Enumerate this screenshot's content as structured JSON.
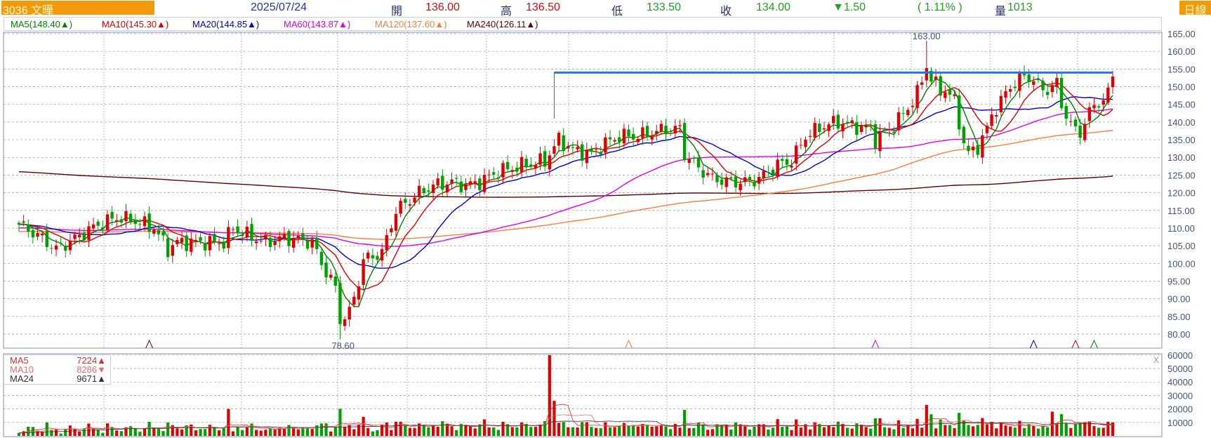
{
  "header": {
    "stock": "3036  文曄",
    "date": "2025/07/24",
    "open_label": "開",
    "open": "136.00",
    "high_label": "高",
    "high": "136.50",
    "low_label": "低",
    "low": "133.50",
    "close_label": "收",
    "close": "134.00",
    "change": "▼1.50",
    "change_pct": "( 1.11% )",
    "volume_label": "量",
    "volume": "1013",
    "period": "日線"
  },
  "ma_legend": [
    {
      "text": "MA5(148.40▲)",
      "color": "#008000"
    },
    {
      "text": "MA10(145.30▲)",
      "color": "#e00000"
    },
    {
      "text": "MA20(144.85▲)",
      "color": "#0000cc"
    },
    {
      "text": "MA60(143.87▲)",
      "color": "#e000e0"
    },
    {
      "text": "MA120(137.60▲)",
      "color": "#f08040"
    },
    {
      "text": "MA240(126.11▲)",
      "color": "#600000"
    }
  ],
  "volume_legend": [
    {
      "name": "MA5",
      "value": "7224▲",
      "color": "#d03030"
    },
    {
      "name": "MA10",
      "value": "8286▼",
      "color": "#e07070"
    },
    {
      "name": "MA24",
      "value": "9671▲",
      "color": "#333333"
    }
  ],
  "annotations": {
    "high_label": "163.00",
    "low_label": "78.60"
  },
  "colors": {
    "up": "#e00000",
    "down": "#00a000",
    "resistance": "#1e78e6",
    "grid": "#999999",
    "axis_text": "#445577"
  },
  "chart_data": {
    "type": "candlestick",
    "days": 236,
    "price_axis": {
      "min": 80,
      "max": 165,
      "step": 5,
      "ticks": [
        "165.00",
        "160.00",
        "155.00",
        "150.00",
        "145.00",
        "140.00",
        "135.00",
        "130.00",
        "125.00",
        "120.00",
        "115.00",
        "110.00",
        "105.00",
        "100.00",
        "95.00",
        "90.00",
        "85.00",
        "80.00"
      ]
    },
    "volume_axis": {
      "min": 0,
      "max": 60000,
      "ticks": [
        "60000",
        "50000",
        "40000",
        "30000",
        "20000",
        "10000"
      ]
    },
    "price_path": [
      [
        0,
        111
      ],
      [
        4,
        108
      ],
      [
        8,
        104
      ],
      [
        12,
        107
      ],
      [
        17,
        111
      ],
      [
        21,
        113
      ],
      [
        25,
        112
      ],
      [
        29,
        110
      ],
      [
        32,
        104
      ],
      [
        34,
        106
      ],
      [
        39,
        106
      ],
      [
        44,
        106
      ],
      [
        46,
        110
      ],
      [
        49,
        108
      ],
      [
        53,
        106
      ],
      [
        56,
        107
      ],
      [
        59,
        107
      ],
      [
        63,
        106
      ],
      [
        65,
        100
      ],
      [
        68,
        93
      ],
      [
        69,
        84
      ],
      [
        71,
        86
      ],
      [
        73,
        95
      ],
      [
        74,
        101
      ],
      [
        78,
        103
      ],
      [
        79,
        107
      ],
      [
        81,
        115
      ],
      [
        83,
        117
      ],
      [
        86,
        120
      ],
      [
        89,
        122
      ],
      [
        93,
        123
      ],
      [
        96,
        122
      ],
      [
        99,
        123
      ],
      [
        103,
        126
      ],
      [
        106,
        127
      ],
      [
        109,
        128
      ],
      [
        113,
        129
      ],
      [
        116,
        135
      ],
      [
        119,
        132
      ],
      [
        123,
        131
      ],
      [
        126,
        134
      ],
      [
        129,
        136
      ],
      [
        133,
        136
      ],
      [
        136,
        137
      ],
      [
        139,
        138
      ],
      [
        142,
        138
      ],
      [
        143,
        131
      ],
      [
        146,
        127
      ],
      [
        149,
        124
      ],
      [
        153,
        123
      ],
      [
        156,
        123
      ],
      [
        159,
        124
      ],
      [
        163,
        128
      ],
      [
        166,
        129
      ],
      [
        169,
        136
      ],
      [
        173,
        139
      ],
      [
        176,
        140
      ],
      [
        179,
        139
      ],
      [
        183,
        138
      ],
      [
        184,
        135
      ],
      [
        188,
        139
      ],
      [
        191,
        144
      ],
      [
        193,
        148
      ],
      [
        195,
        156
      ],
      [
        196,
        152
      ],
      [
        198,
        149
      ],
      [
        199,
        149
      ],
      [
        201,
        146
      ],
      [
        203,
        134
      ],
      [
        204,
        131
      ],
      [
        206,
        133
      ],
      [
        208,
        138
      ],
      [
        209,
        142
      ],
      [
        211,
        146
      ],
      [
        213,
        150
      ],
      [
        214,
        151
      ],
      [
        216,
        153
      ],
      [
        218,
        152
      ],
      [
        219,
        150
      ],
      [
        221,
        149
      ],
      [
        223,
        151
      ],
      [
        224,
        145
      ],
      [
        226,
        139
      ],
      [
        228,
        137
      ],
      [
        229,
        140
      ],
      [
        231,
        145
      ],
      [
        233,
        146
      ],
      [
        234,
        148
      ],
      [
        235,
        154
      ]
    ],
    "volume_spikes": [
      [
        45,
        20000
      ],
      [
        114,
        60000
      ],
      [
        115,
        26000
      ],
      [
        195,
        23000
      ],
      [
        196,
        16000
      ],
      [
        222,
        18000
      ]
    ],
    "resistance_line": {
      "price": 154,
      "from_day": 115,
      "to_day": 235
    },
    "signal_markers": [
      {
        "day": 28,
        "color": "#800000"
      },
      {
        "day": 131,
        "color": "#f08040"
      },
      {
        "day": 184,
        "color": "#e000e0"
      },
      {
        "day": 218,
        "color": "#0000cc"
      },
      {
        "day": 227,
        "color": "#e00000"
      },
      {
        "day": 231,
        "color": "#008000"
      }
    ]
  }
}
